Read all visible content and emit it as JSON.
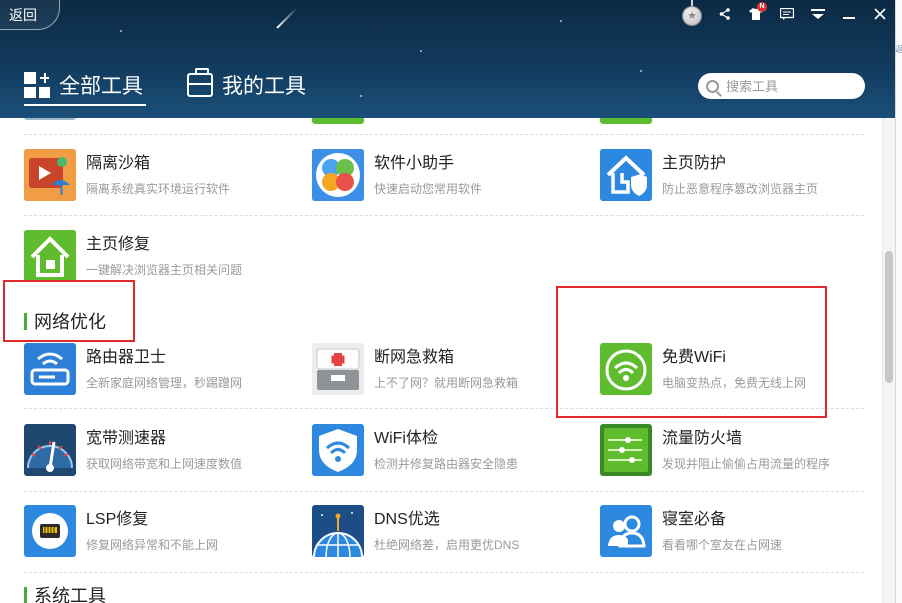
{
  "header": {
    "back_label": "返回",
    "tabs": [
      {
        "label": "全部工具",
        "icon": "grid-plus-icon",
        "active": true
      },
      {
        "label": "我的工具",
        "icon": "toolbox-icon",
        "active": false
      }
    ],
    "search": {
      "placeholder": "搜索工具"
    },
    "window_controls": [
      {
        "name": "skin-icon"
      },
      {
        "name": "share-icon",
        "glyph": "⟨"
      },
      {
        "name": "shirt-icon",
        "badge": "N"
      },
      {
        "name": "message-icon"
      },
      {
        "name": "menu-icon"
      },
      {
        "name": "minimize-icon",
        "glyph": "—"
      },
      {
        "name": "close-icon",
        "glyph": "✕"
      }
    ]
  },
  "tools_top": [
    {
      "title": "隔离沙箱",
      "desc": "隔离系统真实环境运行软件",
      "icon": "sandbox-icon"
    },
    {
      "title": "软件小助手",
      "desc": "快速启动您常用软件",
      "icon": "software-helper-icon"
    },
    {
      "title": "主页防护",
      "desc": "防止恶意程序篡改浏览器主页",
      "icon": "homepage-protect-icon"
    },
    {
      "title": "主页修复",
      "desc": "一键解决浏览器主页相关问题",
      "icon": "homepage-repair-icon"
    }
  ],
  "sections": [
    {
      "label": "网络优化"
    },
    {
      "label": "系统工具"
    }
  ],
  "network_tools": [
    {
      "title": "路由器卫士",
      "desc": "全新家庭网络管理，秒踢蹭网",
      "icon": "router-icon"
    },
    {
      "title": "断网急救箱",
      "desc": "上不了网？就用断网急救箱",
      "icon": "first-aid-icon"
    },
    {
      "title": "免费WiFi",
      "desc": "电脑变热点，免费无线上网",
      "icon": "free-wifi-icon"
    },
    {
      "title": "宽带测速器",
      "desc": "获取网络带宽和上网速度数值",
      "icon": "speed-test-icon"
    },
    {
      "title": "WiFi体检",
      "desc": "检测并修复路由器安全隐患",
      "icon": "wifi-check-icon"
    },
    {
      "title": "流量防火墙",
      "desc": "发现并阻止偷偷占用流量的程序",
      "icon": "traffic-firewall-icon"
    },
    {
      "title": "LSP修复",
      "desc": "修复网络异常和不能上网",
      "icon": "lsp-repair-icon"
    },
    {
      "title": "DNS优选",
      "desc": "杜绝网络差，启用更优DNS",
      "icon": "dns-icon"
    },
    {
      "title": "寝室必备",
      "desc": "看看哪个室友在占网速",
      "icon": "dorm-icon"
    }
  ],
  "side_strip_text": "返",
  "colors": {
    "accent_green": "#5ebc2e",
    "accent_blue": "#2d88e0",
    "annotation_red": "#e32a2a",
    "header_bg": "#123a5c"
  }
}
